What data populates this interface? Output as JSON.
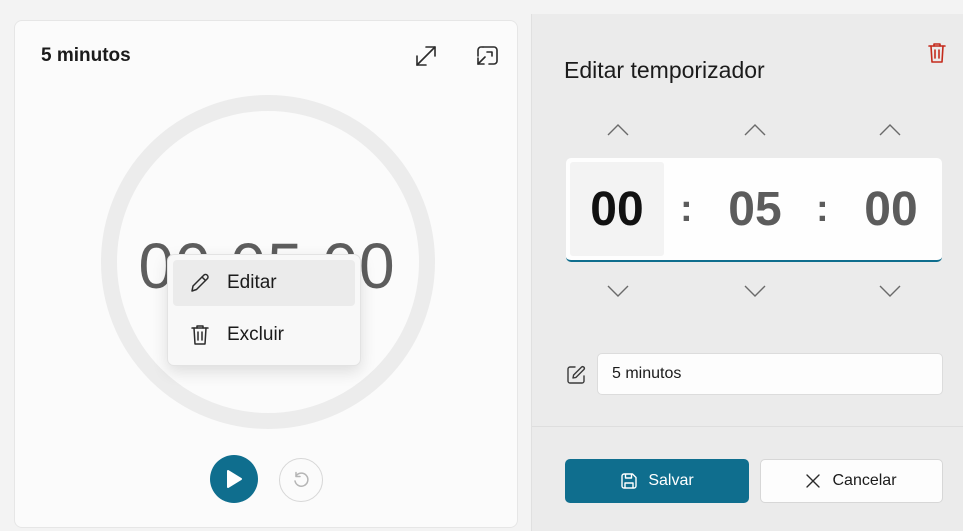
{
  "timer_card": {
    "title": "5 minutos",
    "display_time": "00:05:00",
    "icons": {
      "expand": "expand-icon",
      "compact": "compact-overlay-icon",
      "play": "play-icon",
      "reset": "reset-icon"
    }
  },
  "context_menu": {
    "items": [
      {
        "label": "Editar",
        "icon": "pencil-icon"
      },
      {
        "label": "Excluir",
        "icon": "trash-icon"
      }
    ]
  },
  "edit_panel": {
    "title": "Editar temporizador",
    "hours": "00",
    "minutes": "05",
    "seconds": "00",
    "separator": ":",
    "name_value": "5 minutos",
    "save_label": "Salvar",
    "cancel_label": "Cancelar"
  },
  "colors": {
    "accent": "#0f6e8e",
    "delete": "#c42b1c"
  }
}
